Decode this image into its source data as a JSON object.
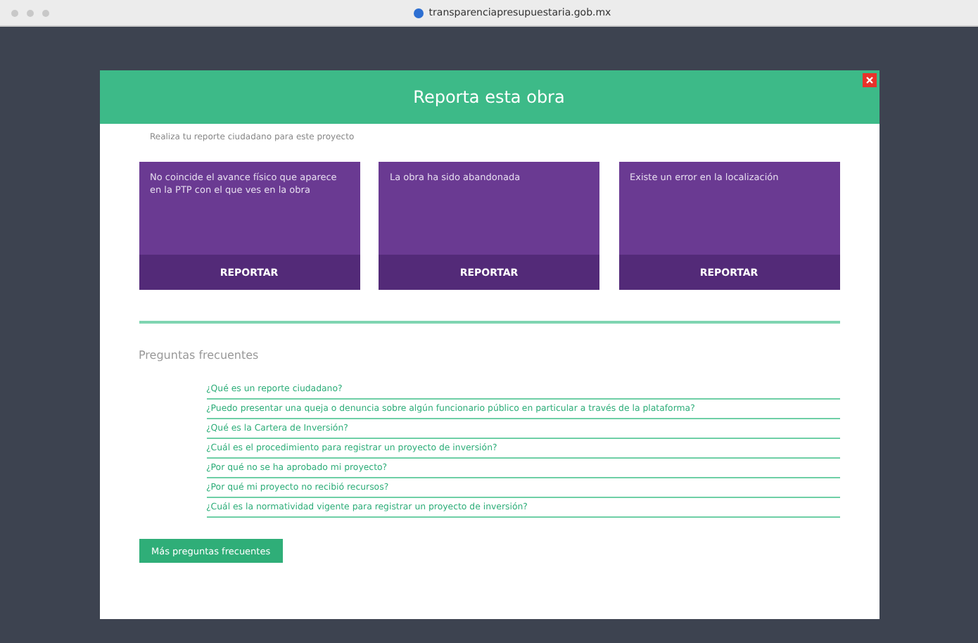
{
  "browser": {
    "url": "transparenciapresupuestaria.gob.mx"
  },
  "modal": {
    "title": "Reporta esta obra",
    "intro": "Realiza tu reporte ciudadano para este proyecto",
    "cards": [
      {
        "text": "No coincide el avance físico que aparece en la PTP con el que ves en la obra",
        "action": "REPORTAR"
      },
      {
        "text": "La obra ha sido abandonada",
        "action": "REPORTAR"
      },
      {
        "text": "Existe un error en la localización",
        "action": "REPORTAR"
      }
    ],
    "faq_title": "Preguntas frecuentes",
    "faq": [
      "¿Qué es un reporte ciudadano?",
      "¿Puedo presentar una queja o denuncia sobre algún funcionario público en particular a través de la plataforma?",
      "¿Qué es la Cartera de Inversión?",
      "¿Cuál es el procedimiento para registrar un proyecto de inversión?",
      "¿Por qué no se ha aprobado mi proyecto?",
      "¿Por qué mi proyecto no recibió recursos?",
      "¿Cuál es la normatividad vigente para registrar un proyecto de inversión?"
    ],
    "more_button": "Más preguntas frecuentes"
  }
}
